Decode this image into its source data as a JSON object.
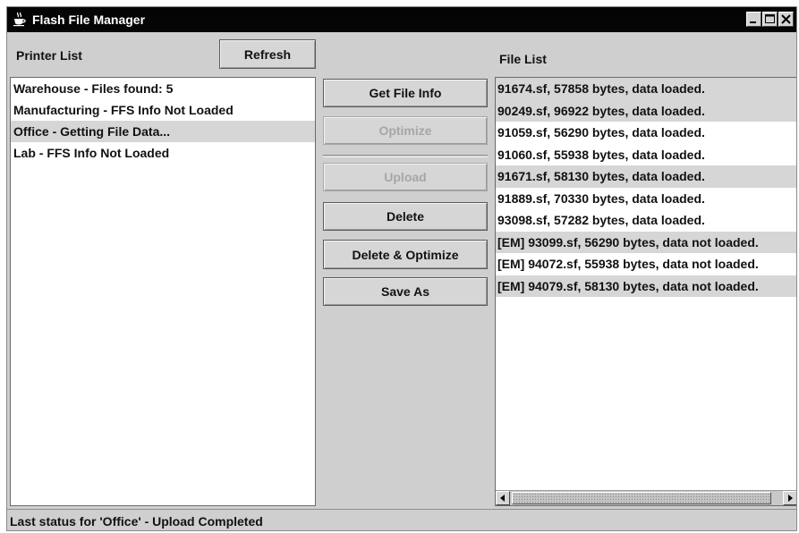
{
  "window": {
    "title": "Flash File Manager",
    "icon": "java-cup-icon",
    "controls": [
      "minimize-icon",
      "maximize-icon",
      "close-icon"
    ]
  },
  "printer_panel": {
    "label": "Printer List",
    "refresh_label": "Refresh",
    "printers": [
      {
        "text": "Warehouse - Files found: 5",
        "selected": false
      },
      {
        "text": "Manufacturing - FFS Info Not Loaded",
        "selected": false
      },
      {
        "text": "Office - Getting File Data...",
        "selected": true
      },
      {
        "text": "Lab - FFS Info Not Loaded",
        "selected": false
      }
    ]
  },
  "actions": {
    "get_file_info": {
      "label": "Get File Info",
      "enabled": true
    },
    "optimize": {
      "label": "Optimize",
      "enabled": false
    },
    "upload": {
      "label": "Upload",
      "enabled": false
    },
    "delete": {
      "label": "Delete",
      "enabled": true
    },
    "delete_optimize": {
      "label": "Delete & Optimize",
      "enabled": true
    },
    "save_as": {
      "label": "Save As",
      "enabled": true
    }
  },
  "file_panel": {
    "label": "File List",
    "files": [
      {
        "text": "91674.sf, 57858 bytes, data loaded.",
        "selected": true
      },
      {
        "text": "90249.sf, 96922 bytes, data loaded.",
        "selected": true
      },
      {
        "text": "91059.sf, 56290 bytes, data loaded.",
        "selected": false
      },
      {
        "text": "91060.sf, 55938 bytes, data loaded.",
        "selected": false
      },
      {
        "text": "91671.sf, 58130 bytes, data loaded.",
        "selected": true
      },
      {
        "text": "91889.sf, 70330 bytes, data loaded.",
        "selected": false
      },
      {
        "text": "93098.sf, 57282 bytes, data loaded.",
        "selected": false
      },
      {
        "text": "[EM] 93099.sf, 56290 bytes, data not loaded.",
        "selected": true
      },
      {
        "text": "[EM] 94072.sf, 55938 bytes, data not loaded.",
        "selected": false
      },
      {
        "text": "[EM] 94079.sf, 58130 bytes, data not loaded.",
        "selected": true
      }
    ]
  },
  "status": {
    "text": "Last status for 'Office' - Upload Completed"
  },
  "colors": {
    "titlebar": "#050505",
    "window_bg": "#cfcfcf",
    "selection": "#d6d6d6",
    "disabled_text": "#a6a6a6"
  }
}
